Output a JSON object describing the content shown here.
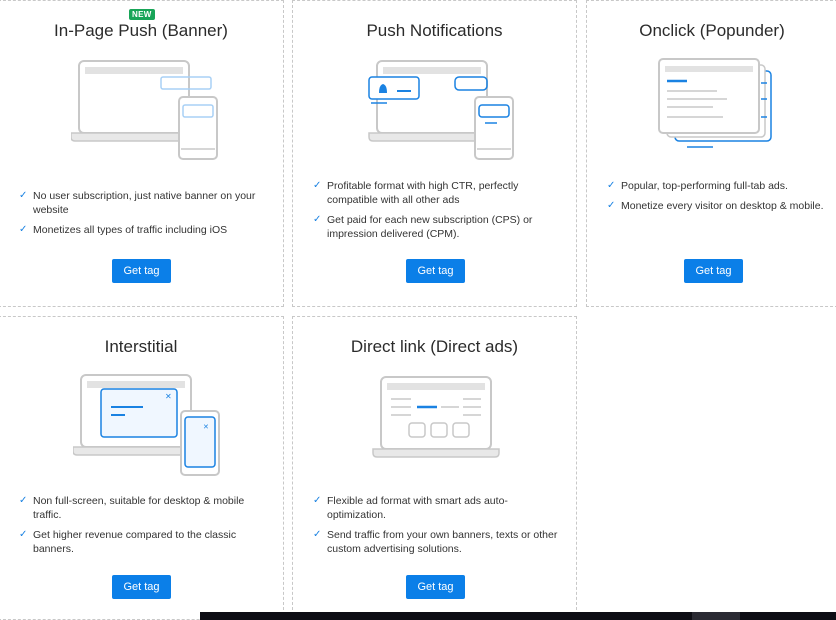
{
  "colors": {
    "accent": "#0b7fe8",
    "new_badge": "#18a558",
    "illustration_gray": "#c8c8c8",
    "illustration_blue": "#1a82e2"
  },
  "cards": [
    {
      "title": "In-Page Push (Banner)",
      "badge": "NEW",
      "features": [
        "No user subscription, just native banner on your website",
        "Monetizes all types of traffic including iOS"
      ],
      "button": "Get tag",
      "illustration": "laptop-phone-banner-icon"
    },
    {
      "title": "Push Notifications",
      "features": [
        "Profitable format with high CTR, perfectly compatible with all other ads",
        "Get paid for each new subscription (CPS) or impression delivered (CPM)."
      ],
      "button": "Get tag",
      "illustration": "laptop-notification-bell-icon"
    },
    {
      "title": "Onclick (Popunder)",
      "features": [
        "Popular, top-performing full-tab ads.",
        "Monetize every visitor on desktop & mobile."
      ],
      "button": "Get tag",
      "illustration": "stacked-browser-tabs-icon"
    },
    {
      "title": "Interstitial",
      "features": [
        "Non full-screen, suitable for desktop & mobile traffic.",
        "Get higher revenue compared to the classic banners."
      ],
      "button": "Get tag",
      "illustration": "laptop-overlay-popup-icon"
    },
    {
      "title": "Direct link (Direct ads)",
      "features": [
        "Flexible ad format with smart ads auto-optimization.",
        "Send traffic from your own banners, texts or other custom advertising solutions."
      ],
      "button": "Get tag",
      "illustration": "laptop-landing-page-icon"
    }
  ]
}
